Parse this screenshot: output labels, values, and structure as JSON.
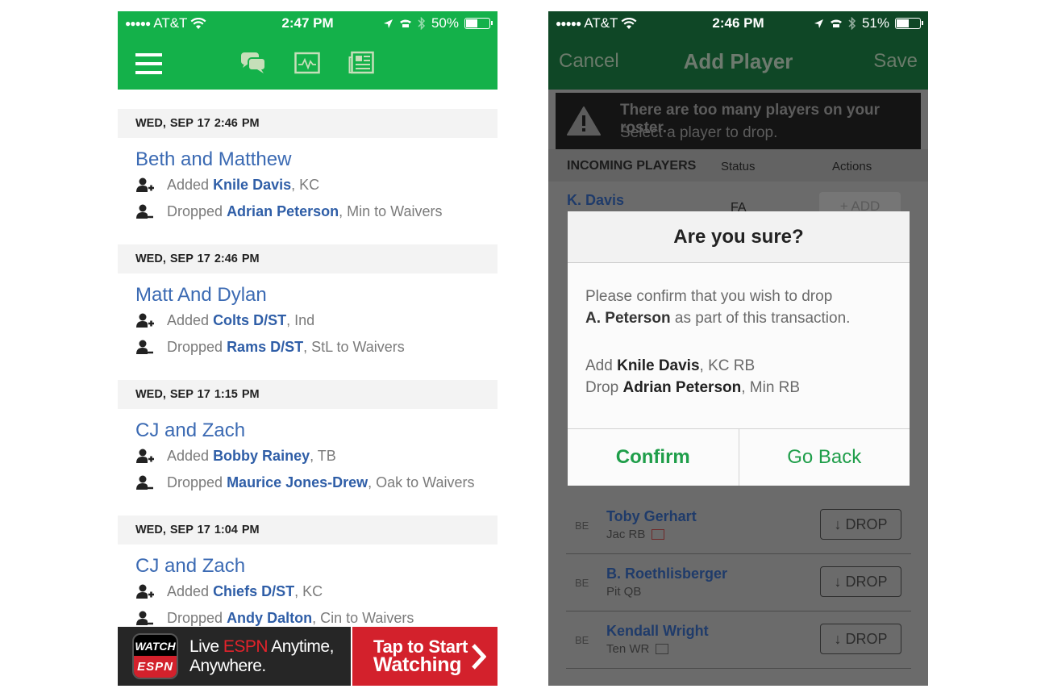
{
  "left_phone": {
    "status": {
      "carrier": "AT&T",
      "time": "2:47 PM",
      "battery": "50%",
      "battery_level": 0.5
    },
    "nav": {
      "icons": [
        "menu-icon",
        "messages-icon",
        "activity-icon",
        "news-icon"
      ]
    },
    "feed": [
      {
        "date": "WED, SEP 17  2:46 PM",
        "team": "Beth and Matthew",
        "added": {
          "prefix": "Added ",
          "player": "Knile Davis",
          "suffix": ", KC"
        },
        "dropped": {
          "prefix": "Dropped ",
          "player": "Adrian Peterson",
          "suffix": ", Min to Waivers"
        }
      },
      {
        "date": "WED, SEP 17  2:46 PM",
        "team": "Matt And Dylan",
        "added": {
          "prefix": "Added ",
          "player": "Colts D/ST",
          "suffix": ", Ind"
        },
        "dropped": {
          "prefix": "Dropped ",
          "player": "Rams D/ST",
          "suffix": ", StL to Waivers"
        }
      },
      {
        "date": "WED, SEP 17  1:15 PM",
        "team": "CJ and Zach",
        "added": {
          "prefix": "Added ",
          "player": "Bobby Rainey",
          "suffix": ", TB"
        },
        "dropped": {
          "prefix": "Dropped ",
          "player": "Maurice Jones-Drew",
          "suffix": ", Oak to Waivers"
        }
      },
      {
        "date": "WED, SEP 17  1:04 PM",
        "team": "CJ and Zach",
        "added": {
          "prefix": "Added ",
          "player": "Chiefs D/ST",
          "suffix": ", KC"
        },
        "dropped": {
          "prefix": "Dropped ",
          "player": "Andy Dalton",
          "suffix": ", Cin to Waivers"
        }
      }
    ],
    "ad": {
      "logo_top": "WATCH",
      "logo_bottom": "ESPN",
      "tag_pre": "Live ",
      "tag_brand": "ESPN",
      "tag_post": " Anytime,",
      "tag_line2": "Anywhere.",
      "cta_line1": "Tap to Start",
      "cta_line2": "Watching"
    }
  },
  "right_phone": {
    "status": {
      "carrier": "AT&T",
      "time": "2:46 PM",
      "battery": "51%",
      "battery_level": 0.51
    },
    "nav": {
      "cancel": "Cancel",
      "title": "Add Player",
      "save": "Save"
    },
    "alert": {
      "line1": "There are too many players on your roster.",
      "line2": "Select a player to drop."
    },
    "incoming": {
      "headers": [
        "INCOMING PLAYERS",
        "Status",
        "Actions"
      ],
      "player": "K. Davis",
      "status": "FA",
      "action": "+ ADD"
    },
    "roster": [
      {
        "slot": "BE",
        "name": "Toby Gerhart",
        "meta": "Jac RB",
        "news": "red",
        "action": "DROP"
      },
      {
        "slot": "BE",
        "name": "B. Roethlisberger",
        "meta": "Pit QB",
        "news": "none",
        "action": "DROP"
      },
      {
        "slot": "BE",
        "name": "Kendall Wright",
        "meta": "Ten WR",
        "news": "gray",
        "action": "DROP"
      }
    ],
    "modal": {
      "title": "Are you sure?",
      "msg_line1": "Please confirm that you wish to drop",
      "msg_bold": "A. Peterson",
      "msg_line2": " as part of this transaction.",
      "add_label": "Add ",
      "add_player": "Knile Davis",
      "add_suffix": ", KC RB",
      "drop_label": "Drop ",
      "drop_player": "Adrian Peterson",
      "drop_suffix": ", Min RB",
      "confirm": "Confirm",
      "go_back": "Go Back"
    },
    "colors": {
      "header": "#0f4726",
      "accent": "#1f9e4a"
    }
  },
  "colors": {
    "espn_green": "#14b14a",
    "link_blue": "#3b6ab3",
    "espn_red": "#d3212c"
  }
}
